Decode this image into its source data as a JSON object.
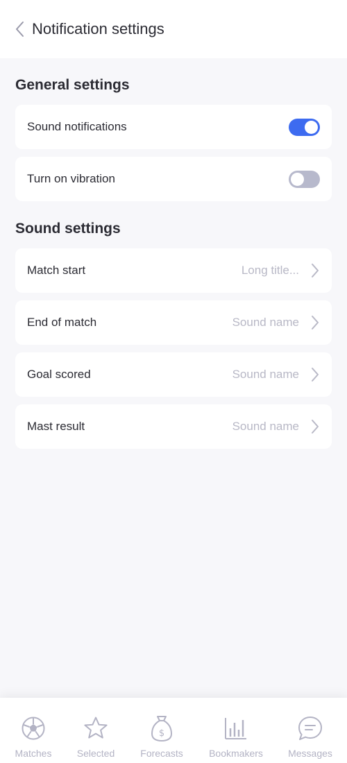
{
  "header": {
    "title": "Notification settings",
    "back_icon": "chevron-left-icon"
  },
  "general": {
    "title": "General settings",
    "items": [
      {
        "label": "Sound notifications",
        "enabled": true
      },
      {
        "label": "Turn on vibration",
        "enabled": false
      }
    ]
  },
  "sound": {
    "title": "Sound settings",
    "items": [
      {
        "label": "Match start",
        "value": "Long title..."
      },
      {
        "label": "End of match",
        "value": "Sound name"
      },
      {
        "label": "Goal scored",
        "value": "Sound name"
      },
      {
        "label": "Mast result",
        "value": "Sound name"
      }
    ]
  },
  "nav": {
    "items": [
      {
        "label": "Matches",
        "icon": "soccer-ball-icon"
      },
      {
        "label": "Selected",
        "icon": "star-icon"
      },
      {
        "label": "Forecasts",
        "icon": "money-bag-icon"
      },
      {
        "label": "Bookmakers",
        "icon": "bar-chart-icon"
      },
      {
        "label": "Messages",
        "icon": "chat-bubble-icon"
      }
    ]
  },
  "colors": {
    "accent": "#3d6bf0",
    "toggle_off": "#b7b9cc",
    "background": "#f7f7fa",
    "muted_text": "#b8b8c6"
  }
}
